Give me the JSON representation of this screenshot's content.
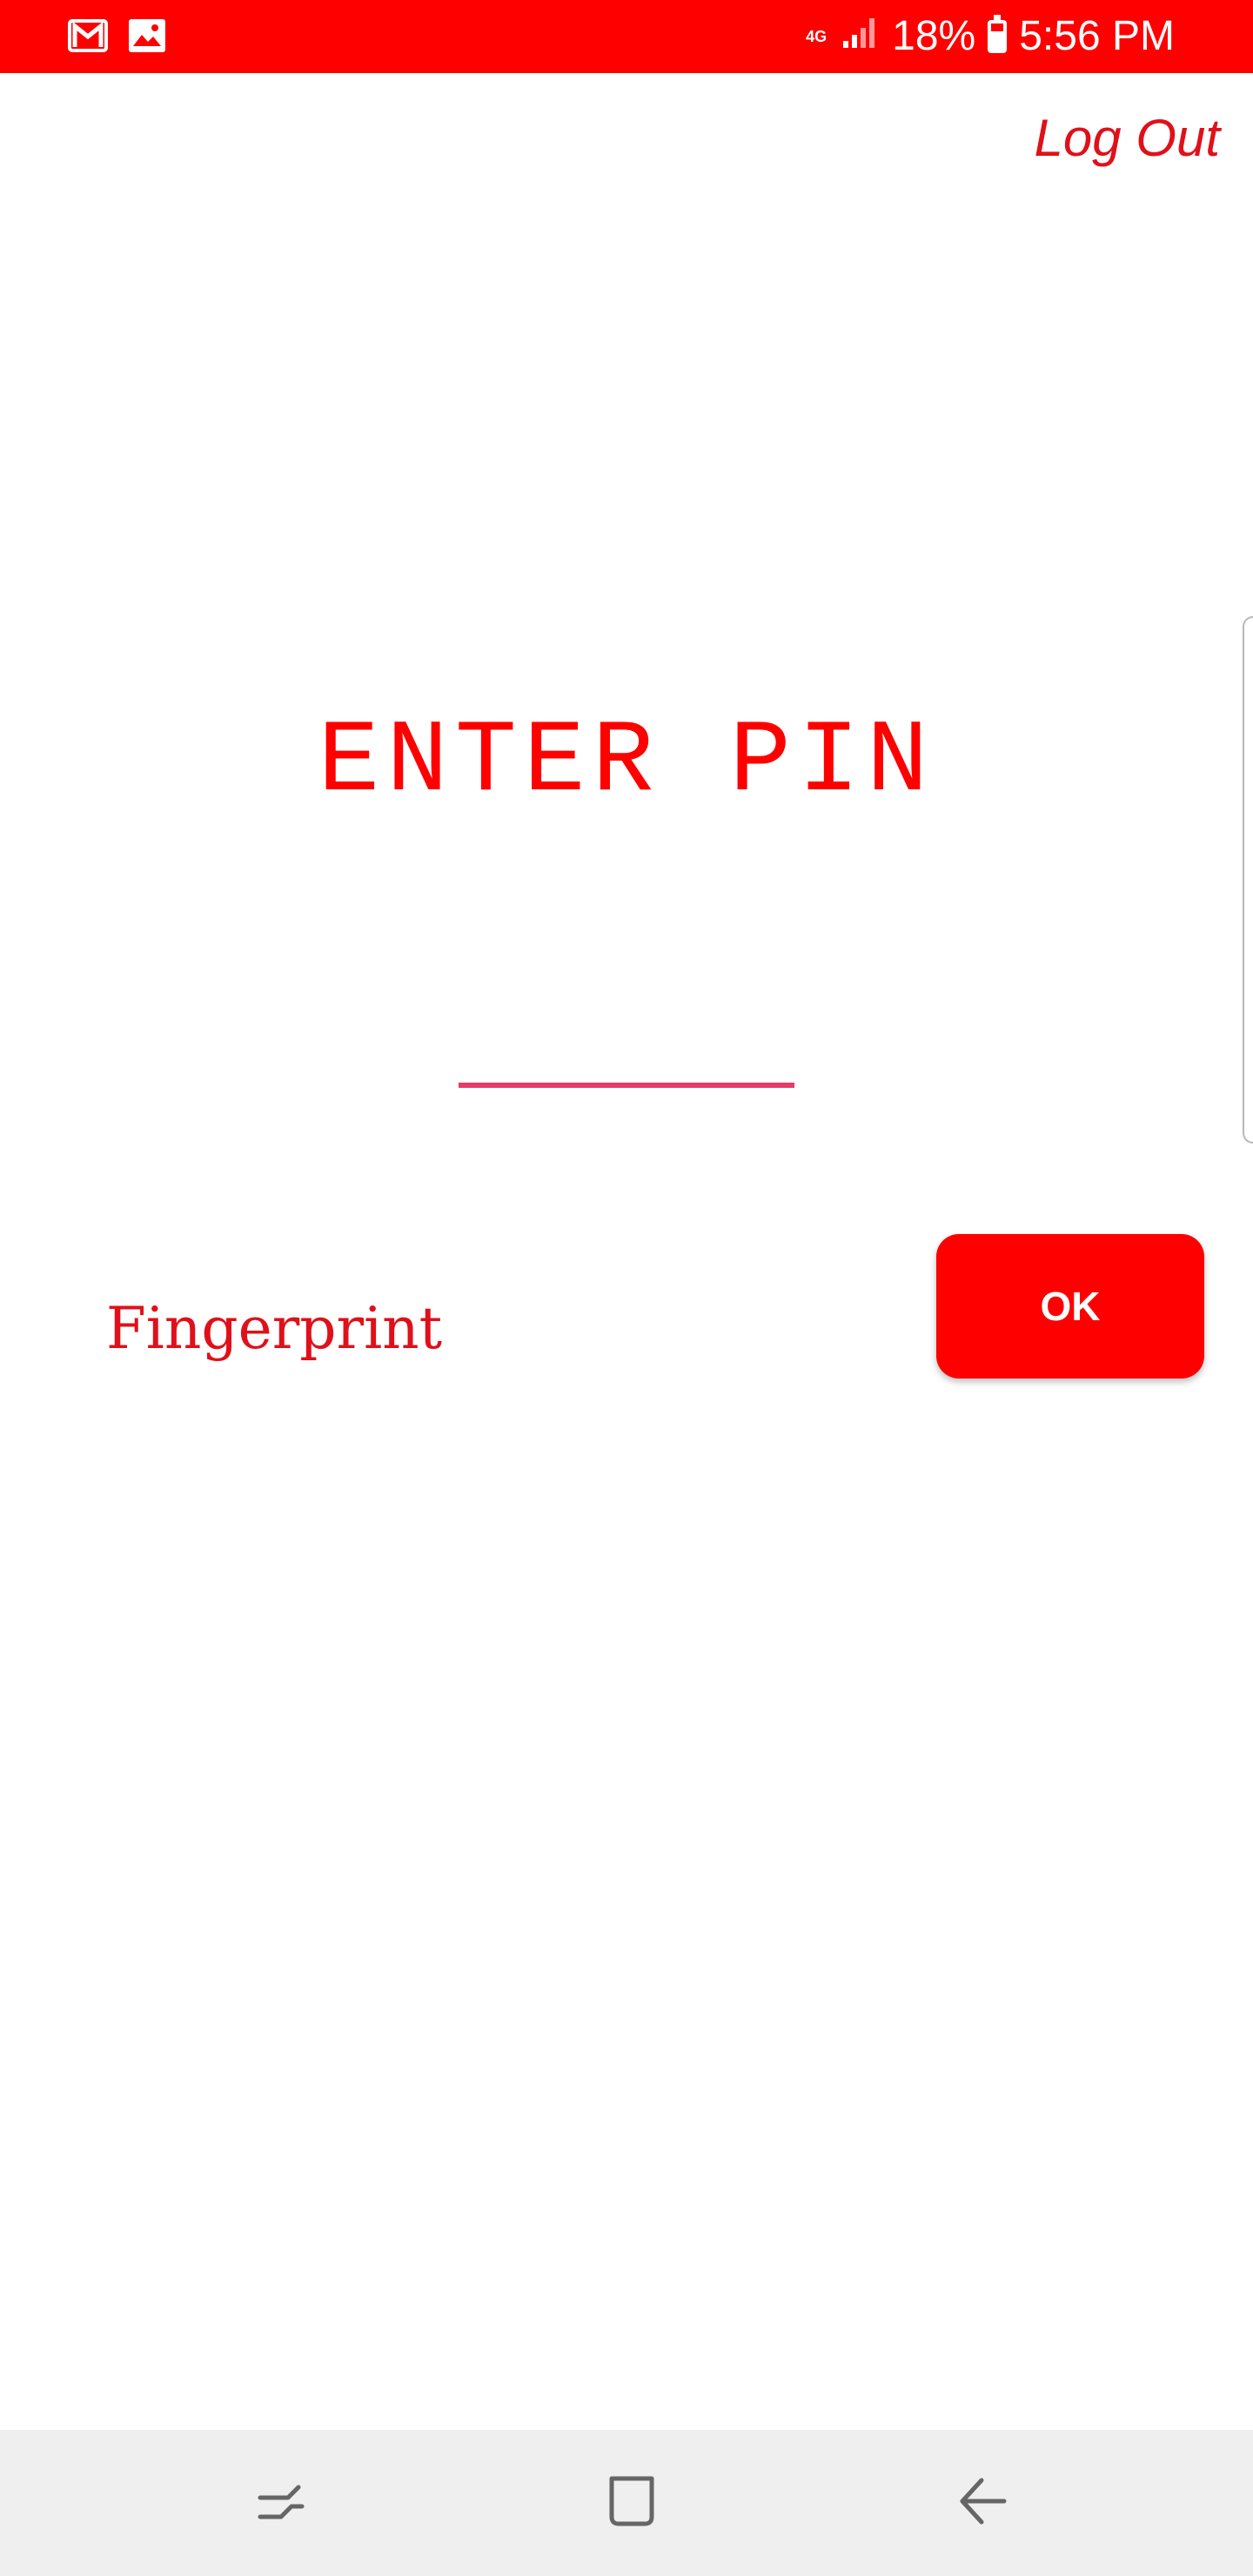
{
  "status_bar": {
    "battery_percent": "18%",
    "time": "5:56 PM",
    "network_tag": "4G",
    "icons": [
      "gmail-icon",
      "gallery-icon",
      "network-4g-icon",
      "signal-icon",
      "battery-icon"
    ],
    "background_color": "#fe0000"
  },
  "header": {
    "logout_label": "Log Out"
  },
  "main": {
    "title": "ENTER PIN",
    "pin_value": "",
    "fingerprint_label": "Fingerprint",
    "ok_label": "OK"
  },
  "nav_bar": {
    "icons": [
      "recent-apps-icon",
      "home-icon",
      "back-icon"
    ]
  },
  "colors": {
    "accent": "#fe0000",
    "input_underline": "#e8396a",
    "nav_background": "#efefef"
  }
}
